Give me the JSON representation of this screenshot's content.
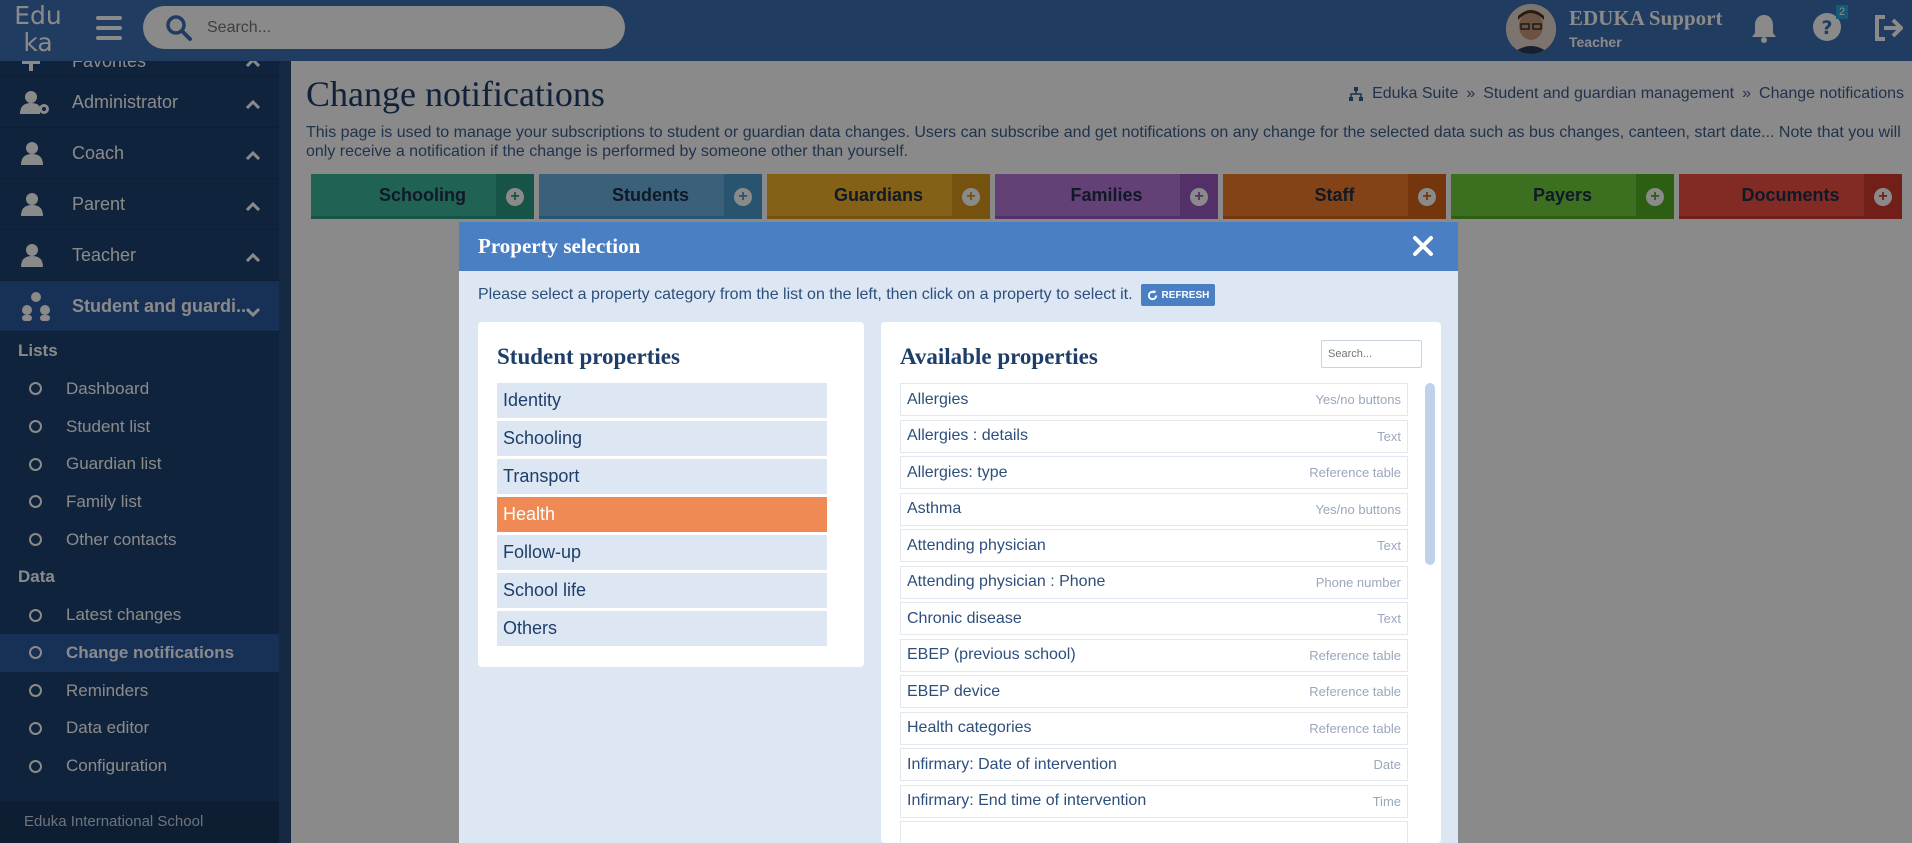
{
  "app": {
    "logo_line1": "Edu",
    "logo_line2": "ka"
  },
  "search": {
    "placeholder": "Search..."
  },
  "user": {
    "name": "EDUKA Support",
    "role": "Teacher",
    "help_badge": "2"
  },
  "sidebar": {
    "groups": [
      {
        "label": "Favorites"
      },
      {
        "label": "Administrator"
      },
      {
        "label": "Coach"
      },
      {
        "label": "Parent"
      },
      {
        "label": "Teacher"
      },
      {
        "label": "Student and guardi..."
      }
    ],
    "sections": [
      {
        "title": "Lists",
        "links": [
          "Dashboard",
          "Student list",
          "Guardian list",
          "Family list",
          "Other contacts"
        ]
      },
      {
        "title": "Data",
        "links": [
          "Latest changes",
          "Change notifications",
          "Reminders",
          "Data editor",
          "Configuration"
        ]
      }
    ],
    "footer": "Eduka International School"
  },
  "page": {
    "title": "Change notifications",
    "breadcrumb": [
      "Eduka Suite",
      "»",
      "Student and guardian management",
      "»",
      "Change notifications"
    ],
    "description": "This page is used to manage your subscriptions to student or guardian data changes. Users can subscribe and get notifications on any change for the selected data such as bus changes, canteen, start date... Note that you will only receive a notification if the change is performed by someone other than yourself."
  },
  "tabs": [
    {
      "label": "Schooling",
      "color": "#3bb59c",
      "plus_color": "#2e9a84"
    },
    {
      "label": "Students",
      "color": "#6bb4e0",
      "plus_color": "#4b9ccd"
    },
    {
      "label": "Guardians",
      "color": "#f4b329",
      "plus_color": "#d9981a"
    },
    {
      "label": "Families",
      "color": "#b777d9",
      "plus_color": "#9a5abf"
    },
    {
      "label": "Staff",
      "color": "#f47d2b",
      "plus_color": "#d8651a"
    },
    {
      "label": "Payers",
      "color": "#6fcf3b",
      "plus_color": "#54b022"
    },
    {
      "label": "Documents",
      "color": "#f05044",
      "plus_color": "#d43a2f"
    }
  ],
  "modal": {
    "title": "Property selection",
    "intro": "Please select a property category from the list on the left, then click on a property to select it.",
    "refresh_label": "REFRESH",
    "left_title": "Student properties",
    "categories": [
      "Identity",
      "Schooling",
      "Transport",
      "Health",
      "Follow-up",
      "School life",
      "Others"
    ],
    "selected_category": "Health",
    "right_title": "Available properties",
    "search_placeholder": "Search...",
    "properties": [
      {
        "name": "Allergies",
        "type": "Yes/no buttons"
      },
      {
        "name": "Allergies : details",
        "type": "Text"
      },
      {
        "name": "Allergies: type",
        "type": "Reference table"
      },
      {
        "name": "Asthma",
        "type": "Yes/no buttons"
      },
      {
        "name": "Attending physician",
        "type": "Text"
      },
      {
        "name": "Attending physician : Phone",
        "type": "Phone number"
      },
      {
        "name": "Chronic disease",
        "type": "Text"
      },
      {
        "name": "EBEP (previous school)",
        "type": "Reference table"
      },
      {
        "name": "EBEP device",
        "type": "Reference table"
      },
      {
        "name": "Health categories",
        "type": "Reference table"
      },
      {
        "name": "Infirmary: Date of intervention",
        "type": "Date"
      },
      {
        "name": "Infirmary: End time of intervention",
        "type": "Time"
      },
      {
        "name": "",
        "type": ""
      }
    ]
  }
}
